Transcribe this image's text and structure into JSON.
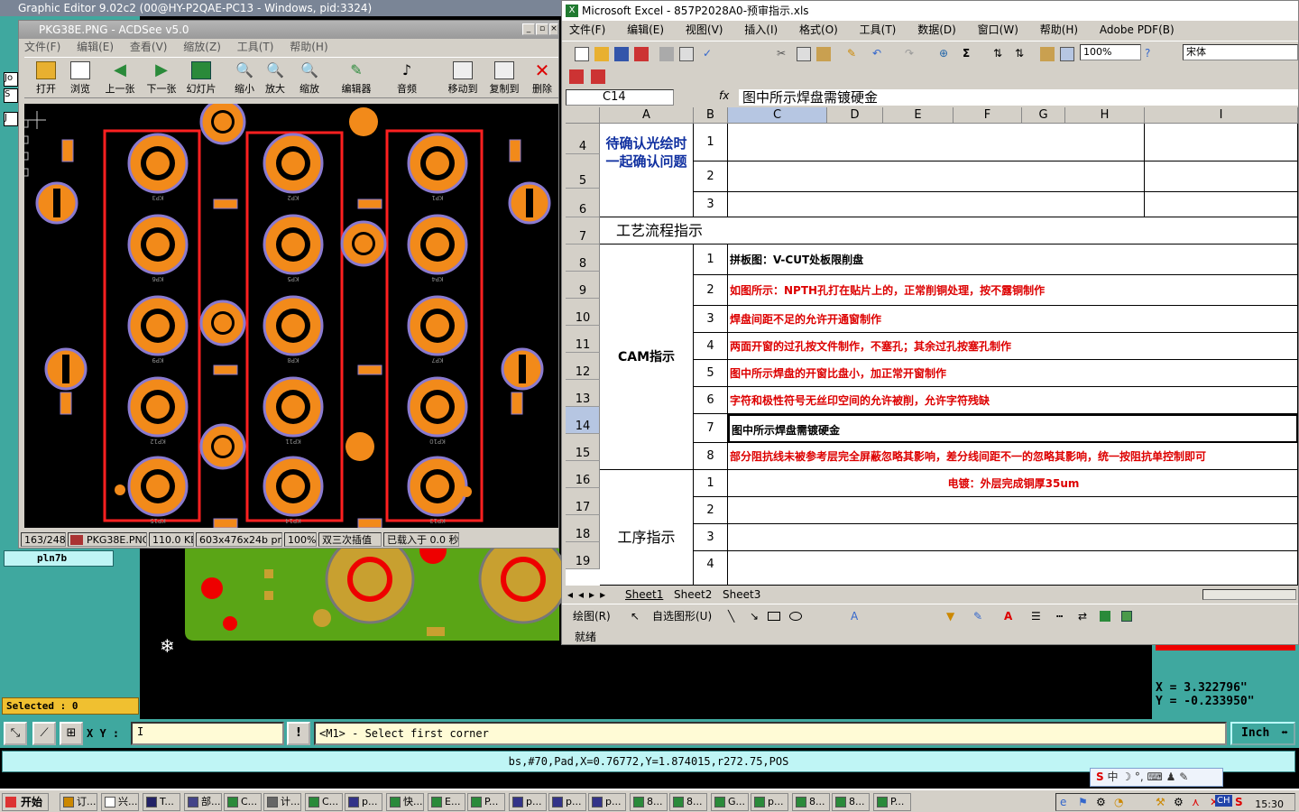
{
  "ge": {
    "title": "Graphic Editor 9.02c2 (00@HY-P2QAE-PC13 - Windows, pid:3324)",
    "left_labels": [
      "Jo",
      "S",
      "J"
    ],
    "layer": "pln7b",
    "selected": "Selected : 0",
    "xy_label": "X Y :",
    "xy_value": "I",
    "prompt": "<M1> - Select first corner",
    "units": "Inch",
    "units_icon": "dropdown-icon",
    "coord_x": "X = 3.322796\"",
    "coord_y": "Y = -0.233950\"",
    "status": "bs,#70,Pad,X=0.76772,Y=1.874015,r272.75,POS",
    "info_glyph": "!"
  },
  "acdsee": {
    "title": "PKG38E.PNG - ACDSee v5.0",
    "menu": [
      "文件(F)",
      "编辑(E)",
      "查看(V)",
      "缩放(Z)",
      "工具(T)",
      "帮助(H)"
    ],
    "toolbar": [
      "打开",
      "浏览",
      "上一张",
      "下一张",
      "幻灯片",
      "缩小",
      "放大",
      "缩放",
      "编辑器",
      "音频",
      "移动到",
      "复制到",
      "删除"
    ],
    "status": [
      "163/248",
      "PKG38E.PNG",
      "110.0 KB",
      "603x476x24b png",
      "100%",
      "双三次插值",
      "已载入于 0.0 秒"
    ],
    "pad_labels_left": [
      "KP3",
      "KP6",
      "KP9",
      "KP12",
      "KP15"
    ],
    "pad_labels_mid": [
      "KP2",
      "KP5",
      "KP8",
      "KP11",
      "KP14"
    ],
    "pad_labels_right": [
      "KP1",
      "KP4",
      "KP7",
      "KP10",
      "KP13"
    ]
  },
  "excel": {
    "title": "Microsoft Excel - 857P2028A0-预审指示.xls",
    "menu": [
      "文件(F)",
      "编辑(E)",
      "视图(V)",
      "插入(I)",
      "格式(O)",
      "工具(T)",
      "数据(D)",
      "窗口(W)",
      "帮助(H)",
      "Adobe PDF(B)"
    ],
    "zoom": "100%",
    "font": "宋体",
    "cell_ref": "C14",
    "fx": "fx",
    "formula": "图中所示焊盘需镀硬金",
    "columns": [
      "A",
      "B",
      "C",
      "D",
      "E",
      "F",
      "G",
      "H",
      "I"
    ],
    "rows": [
      "4",
      "5",
      "6",
      "7",
      "8",
      "9",
      "10",
      "11",
      "12",
      "13",
      "14",
      "15",
      "16",
      "17",
      "18",
      "19"
    ],
    "section_confirm": "待确认光绘时一起确认问题",
    "section_flow": "工艺流程指示",
    "section_cam": "CAM指示",
    "section_process": "工序指示",
    "confirm_nums": [
      "1",
      "2",
      "3"
    ],
    "cam_items": [
      {
        "n": "1",
        "text": "拼板图：V-CUT处板限削盘",
        "color": "black"
      },
      {
        "n": "2",
        "text": "如图所示：NPTH孔打在贴片上的，正常削铜处理，按不露铜制作",
        "color": "red"
      },
      {
        "n": "3",
        "text": "焊盘间距不足的允许开通窗制作",
        "color": "red"
      },
      {
        "n": "4",
        "text": "两面开窗的过孔按文件制作，不塞孔；其余过孔按塞孔制作",
        "color": "red"
      },
      {
        "n": "5",
        "text": "图中所示焊盘的开窗比盘小，加正常开窗制作",
        "color": "red"
      },
      {
        "n": "6",
        "text": "字符和极性符号无丝印空间的允许被削，允许字符残缺",
        "color": "red"
      },
      {
        "n": "7",
        "text": "图中所示焊盘需镀硬金",
        "color": "black"
      },
      {
        "n": "8",
        "text": "部分阻抗线未被参考层完全屏蔽忽略其影响，差分线间距不一的忽略其影响，统一按阻抗单控制即可",
        "color": "red"
      }
    ],
    "process_items": [
      {
        "n": "1",
        "text": "电镀：外层完成铜厚35um"
      },
      {
        "n": "2",
        "text": ""
      },
      {
        "n": "3",
        "text": ""
      },
      {
        "n": "4",
        "text": ""
      }
    ],
    "sheets": [
      "Sheet1",
      "Sheet2",
      "Sheet3"
    ],
    "draw_label": "绘图(R)",
    "autoshape": "自选图形(U)",
    "status": "就绪"
  },
  "taskbar": {
    "start": "开始",
    "tasks": [
      "订...",
      "兴...",
      "T...",
      "部...",
      "C...",
      "计...",
      "C...",
      "p...",
      "快...",
      "E...",
      "P...",
      "p...",
      "p...",
      "p...",
      "8...",
      "8...",
      "G...",
      "p...",
      "8...",
      "8...",
      "P..."
    ],
    "clock": "15:30",
    "ime": "中"
  },
  "colors": {
    "pcb_pad": "#f28a1a",
    "pcb_outline": "#ff2020",
    "ge_teal": "#3fa89f",
    "excel_red": "#dd0000"
  }
}
